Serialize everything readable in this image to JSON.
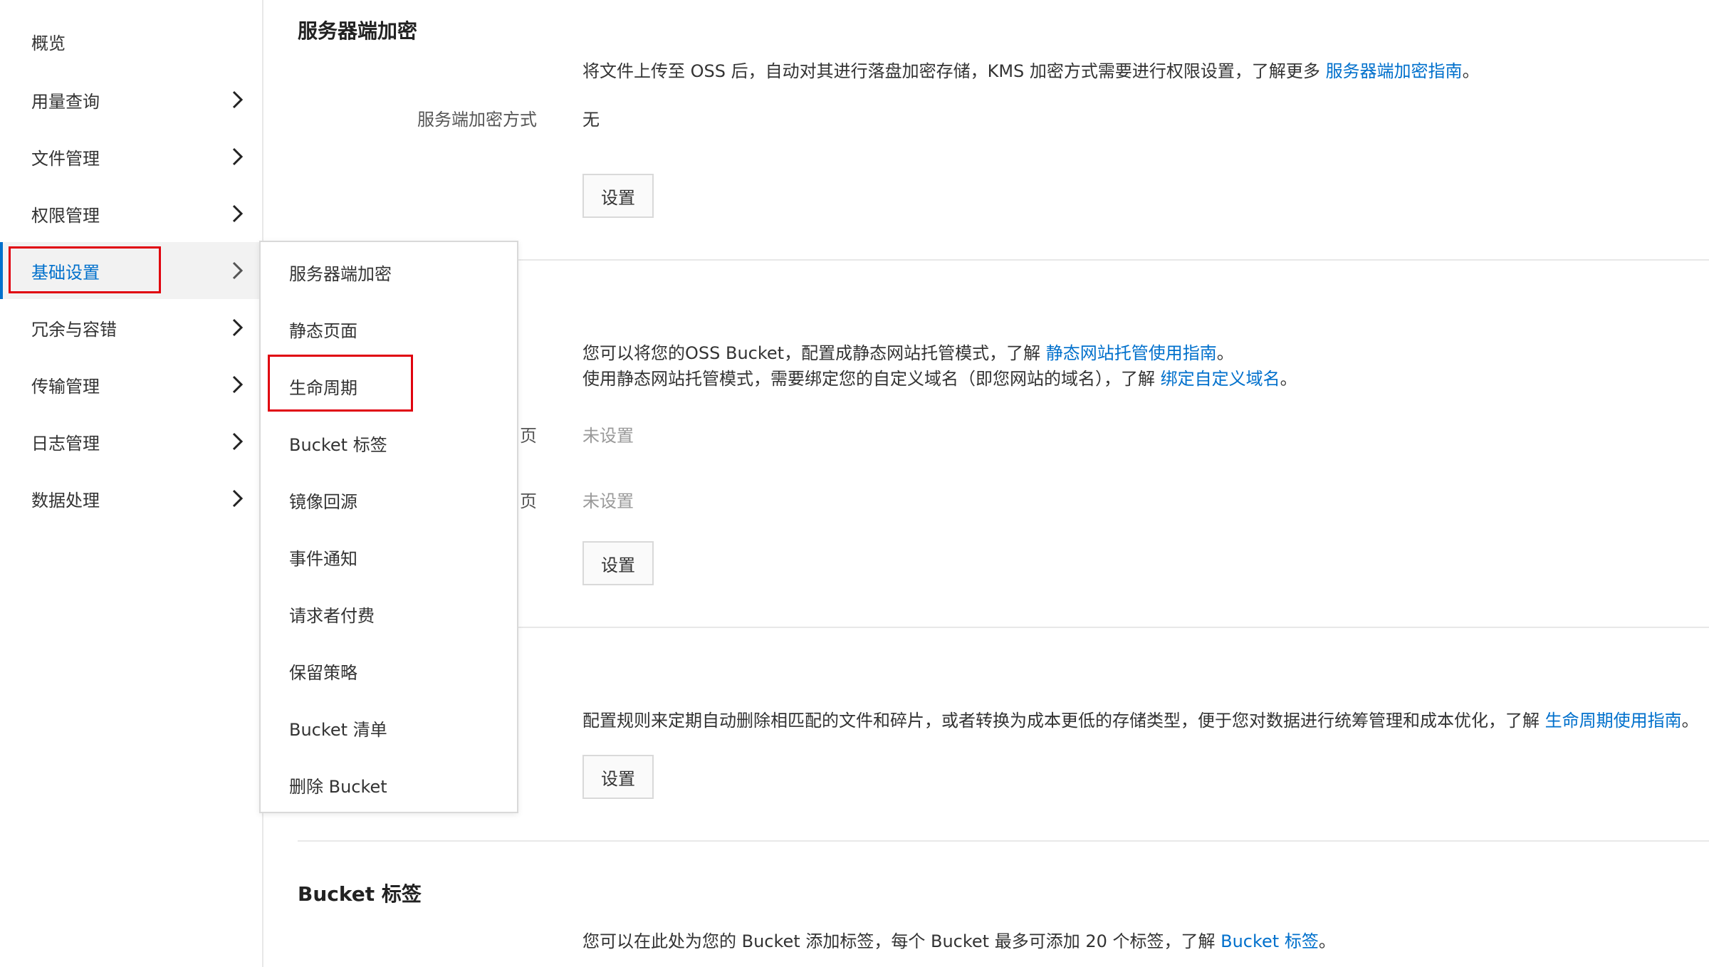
{
  "sidebar": {
    "items": [
      {
        "label": "概览"
      },
      {
        "label": "用量查询"
      },
      {
        "label": "文件管理"
      },
      {
        "label": "权限管理"
      },
      {
        "label": "基础设置"
      },
      {
        "label": "冗余与容错"
      },
      {
        "label": "传输管理"
      },
      {
        "label": "日志管理"
      },
      {
        "label": "数据处理"
      }
    ]
  },
  "submenu": {
    "items": [
      {
        "label": "服务器端加密"
      },
      {
        "label": "静态页面"
      },
      {
        "label": "生命周期"
      },
      {
        "label": "Bucket 标签"
      },
      {
        "label": "镜像回源"
      },
      {
        "label": "事件通知"
      },
      {
        "label": "请求者付费"
      },
      {
        "label": "保留策略"
      },
      {
        "label": "Bucket 清单"
      },
      {
        "label": "删除 Bucket"
      }
    ]
  },
  "encryption": {
    "title": "服务器端加密",
    "desc_text": "将文件上传至 OSS 后，自动对其进行落盘加密存储，KMS 加密方式需要进行权限设置，了解更多 ",
    "desc_link": "服务器端加密指南",
    "desc_end": "。",
    "mode_label": "服务端加密方式",
    "mode_value": "无",
    "button": "设置"
  },
  "static_page": {
    "desc1_text": "您可以将您的OSS Bucket，配置成静态网站托管模式，了解 ",
    "desc1_link": "静态网站托管使用指南",
    "desc1_end": "。",
    "desc2_text": "使用静态网站托管模式，需要绑定您的自定义域名（即您网站的域名），了解 ",
    "desc2_link": "绑定自定义域名",
    "desc2_end": "。",
    "label1_tail": "页",
    "value1": "未设置",
    "label2_tail": "页",
    "value2": "未设置",
    "button": "设置"
  },
  "lifecycle": {
    "desc_text": "配置规则来定期自动删除相匹配的文件和碎片，或者转换为成本更低的存储类型，便于您对数据进行统筹管理和成本优化，了解 ",
    "desc_link": "生命周期使用指南",
    "desc_end": "。",
    "button": "设置"
  },
  "bucket_tags": {
    "title": "Bucket 标签",
    "desc_text": "您可以在此处为您的 Bucket 添加标签，每个 Bucket 最多可添加 20 个标签，了解 ",
    "desc_link": "Bucket 标签",
    "desc_end": "。"
  },
  "colors": {
    "accent": "#0070cc",
    "highlight": "#e0000e"
  }
}
